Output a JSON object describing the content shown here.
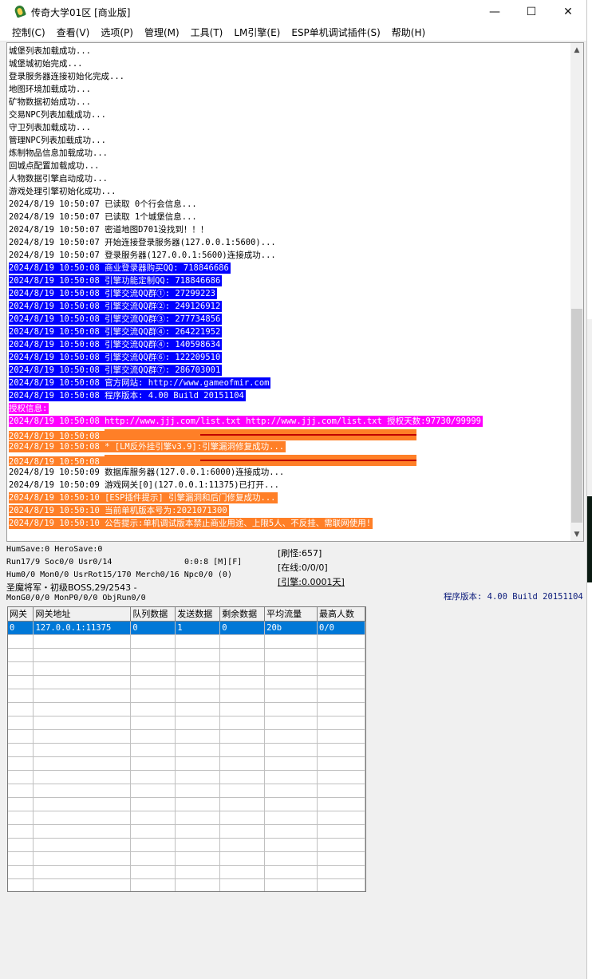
{
  "window": {
    "title": "传奇大学01区 [商业版]",
    "controls": [
      "—",
      "☐",
      "✕"
    ]
  },
  "menu": [
    "控制(C)",
    "查看(V)",
    "选项(P)",
    "管理(M)",
    "工具(T)",
    "LM引擎(E)",
    "ESP单机调试插件(S)",
    "帮助(H)"
  ],
  "log": [
    {
      "text": "城堡列表加载成功...",
      "style": "plain"
    },
    {
      "text": "城堡城初始完成...",
      "style": "plain"
    },
    {
      "text": "登录服务器连接初始化完成...",
      "style": "plain"
    },
    {
      "text": "地图环境加载成功...",
      "style": "plain"
    },
    {
      "text": "矿物数据初始成功...",
      "style": "plain"
    },
    {
      "text": "交易NPC列表加载成功...",
      "style": "plain"
    },
    {
      "text": "守卫列表加载成功...",
      "style": "plain"
    },
    {
      "text": "管理NPC列表加载成功...",
      "style": "plain"
    },
    {
      "text": "炼制物品信息加载成功...",
      "style": "plain"
    },
    {
      "text": "回城点配置加载成功...",
      "style": "plain"
    },
    {
      "text": "人物数据引擎启动成功...",
      "style": "plain"
    },
    {
      "text": "游戏处理引擎初始化成功...",
      "style": "plain"
    },
    {
      "text": "2024/8/19 10:50:07 已读取 0个行会信息...",
      "style": "plain"
    },
    {
      "text": "2024/8/19 10:50:07 已读取 1个城堡信息...",
      "style": "plain"
    },
    {
      "text": "2024/8/19 10:50:07 密道地图D701没找到！！！",
      "style": "plain"
    },
    {
      "text": "2024/8/19 10:50:07 开始连接登录服务器(127.0.0.1:5600)...",
      "style": "plain"
    },
    {
      "text": "2024/8/19 10:50:07 登录服务器(127.0.0.1:5600)连接成功...",
      "style": "plain"
    },
    {
      "text": "2024/8/19 10:50:08 商业登录器购买QQ: 718846686",
      "style": "blue"
    },
    {
      "text": "2024/8/19 10:50:08 引擎功能定制QQ: 718846686",
      "style": "blue"
    },
    {
      "text": "2024/8/19 10:50:08 引擎交流QQ群①: 27299223",
      "style": "blue"
    },
    {
      "text": "2024/8/19 10:50:08 引擎交流QQ群②: 249126912",
      "style": "blue"
    },
    {
      "text": "2024/8/19 10:50:08 引擎交流QQ群③: 277734856",
      "style": "blue"
    },
    {
      "text": "2024/8/19 10:50:08 引擎交流QQ群④: 264221952",
      "style": "blue"
    },
    {
      "text": "2024/8/19 10:50:08 引擎交流QQ群④: 140598634",
      "style": "blue"
    },
    {
      "text": "2024/8/19 10:50:08 引擎交流QQ群⑥: 122209510",
      "style": "blue"
    },
    {
      "text": "2024/8/19 10:50:08 引擎交流QQ群⑦: 286703001",
      "style": "blue"
    },
    {
      "text": "2024/8/19 10:50:08 官方网站: http://www.gameofmir.com",
      "style": "blue"
    },
    {
      "text": "2024/8/19 10:50:08 程序版本: 4.00 Build 20151104",
      "style": "blue"
    },
    {
      "text": "授权信息:",
      "style": "magenta"
    },
    {
      "text": "2024/8/19 10:50:08 http://www.jjj.com/list.txt http://www.jjj.com/list.txt 授权天数:97730/99999",
      "style": "magenta"
    },
    {
      "text": "2024/8/19 10:50:08 ",
      "style": "orange-sep"
    },
    {
      "text": "2024/8/19 10:50:08 * [LM反外挂引擎v3.9]:引擎漏洞修复成功...",
      "style": "orange"
    },
    {
      "text": "2024/8/19 10:50:08 ",
      "style": "orange-sep"
    },
    {
      "text": "2024/8/19 10:50:09 数据库服务器(127.0.0.1:6000)连接成功...",
      "style": "plain"
    },
    {
      "text": "2024/8/19 10:50:09 游戏网关[0](127.0.0.1:11375)已打开...",
      "style": "plain"
    },
    {
      "text": "2024/8/19 10:50:10 [ESP插件提示] 引擎漏洞和后门修复成功...",
      "style": "orange"
    },
    {
      "text": "2024/8/19 10:50:10 当前单机版本号为:2021071300",
      "style": "orange"
    },
    {
      "text": "2024/8/19 10:50:10 公告提示:单机调试版本禁止商业用途、上限5人、不反挂、需联网使用!",
      "style": "orange"
    }
  ],
  "status": {
    "humsave": "HumSave:0 HeroSave:0",
    "run": "Run17/9 Soc0/0 Usr0/14",
    "time": "0:0:8 [M][F]",
    "hum": "Hum0/0 Mon0/0 UsrRot15/170 Merch0/16 Npc0/0 (0)",
    "boss": "圣魔将军・初级BOSS,29/2543 -",
    "mong": "MonG0/0/0 MonP0/0/0 ObjRun0/0",
    "refresh": "[刷怪:657]",
    "online": "[在线:0/0/0]",
    "engine": "[引擎:0.0001天]",
    "version": "程序版本: 4.00 Build 20151104"
  },
  "gateway_table": {
    "headers": [
      "网关",
      "网关地址",
      "队列数据",
      "发送数据",
      "剩余数据",
      "平均流量",
      "最高人数"
    ],
    "rows": [
      [
        "0",
        "127.0.0.1:11375",
        "0",
        "1",
        "0",
        "20b",
        "0/0"
      ]
    ],
    "empty_rows": 19
  },
  "colors": {
    "blue_highlight": "#0000ff",
    "magenta_highlight": "#ff00ff",
    "orange_highlight": "#ff7f27",
    "selection": "#0078d7"
  }
}
